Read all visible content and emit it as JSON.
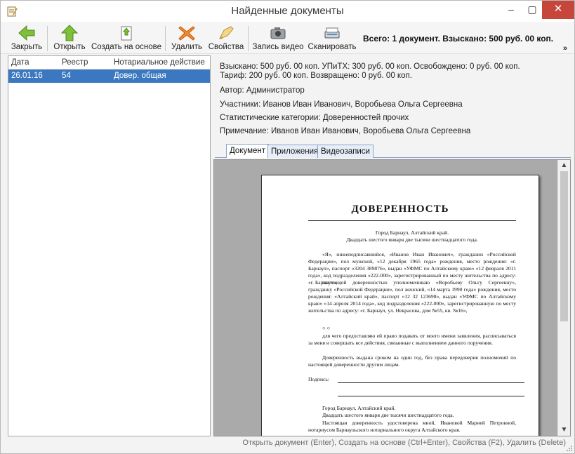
{
  "window": {
    "title": "Найденные документы",
    "minimize": "–",
    "maximize": "▢",
    "close": "✕"
  },
  "toolbar": {
    "close_label": "Закрыть",
    "open_label": "Открыть",
    "create_label": "Создать на основе",
    "delete_label": "Удалить",
    "props_label": "Свойства",
    "record_label": "Запись видео",
    "scan_label": "Сканировать",
    "overflow": "»"
  },
  "summary": "Всего: 1 документ.  Взыскано: 500 руб. 00 коп.",
  "list": {
    "headers": [
      "Дата",
      "Реестр",
      "Нотариальное действие"
    ],
    "rows": [
      {
        "date": "26.01.16",
        "registry": "54",
        "action": "Довер. общая"
      }
    ]
  },
  "info": {
    "line1": "Взыскано: 500 руб. 00 коп. УПиТХ: 300 руб. 00 коп. Освобождено: 0 руб. 00 коп.",
    "line2": "Тариф: 200 руб. 00 коп. Возвращено: 0 руб. 00 коп.",
    "author": "Автор: Администратор",
    "participants": "Участники:  Иванов Иван Иванович,  Воробьева Ольга Сергеевна",
    "categories": "Статистические категории: Доверенностей прочих",
    "note": "Примечание: Иванов Иван Иванович, Воробьева Ольга Сергеевна"
  },
  "tabs": [
    "Документ",
    "Приложения",
    "Видеозаписи"
  ],
  "document": {
    "title": "ДОВЕРЕННОСТЬ",
    "city": "Город Барнаул, Алтайский край.",
    "date": "Двадцать шестого января две тысячи шестнадцатого года.",
    "para1": "«Я», нижеподписавшийся, «Иванов Иван Иванович», гражданин «Российской Федерации», пол мужской, «12 декабря 1965 года» рождения, место рождения: «г. Барнаул», паспорт «3204 389876», выдан «УФМС по Алтайскому краю» «12 февраля 2011 года», код подразделения «222-000», зарегистрированный по месту жительства по адресу: «г. Барнаул»,",
    "para2": "настоящей доверенностью уполномочиваю «Воробьеву Ольгу Сергеевну», гражданку «Российской Федерации», пол женский, «14 марта 1990 года» рождения, место рождения: «Алтайский край», паспорт «12 32 123698», выдан «УФМС по Алтайскому краю» «14 апреля 2014 года», код подразделения «222-000», зарегистрированную по месту жительства по адресу: «г. Барнаул, ул. Некрасова, дом №55, кв. №16»,",
    "marks": "○ ○",
    "para3": "для чего предоставляю ей право подавать от моего имени заявления, расписываться за меня и совершать все действия, связанные с выполнением данного поручения.",
    "para4": "Доверенность выдана сроком на один год, без права передоверия полномочий по настоящей доверенности другим лицам.",
    "signature_label": "Подпись:",
    "city2": "Город Барнаул, Алтайский край.",
    "date2": "Двадцать шестого января две тысячи шестнадцатого года.",
    "para5": "Настоящая доверенность удостоверена мной, Ивановой Марией Петровной, нотариусом Барнаульского нотариального округа Алтайского края."
  },
  "scroll": {
    "up": "▲",
    "down": "▼"
  },
  "statusbar": "Открыть документ (Enter), Создать на основе (Ctrl+Enter), Свойства (F2), Удалить (Delete)"
}
